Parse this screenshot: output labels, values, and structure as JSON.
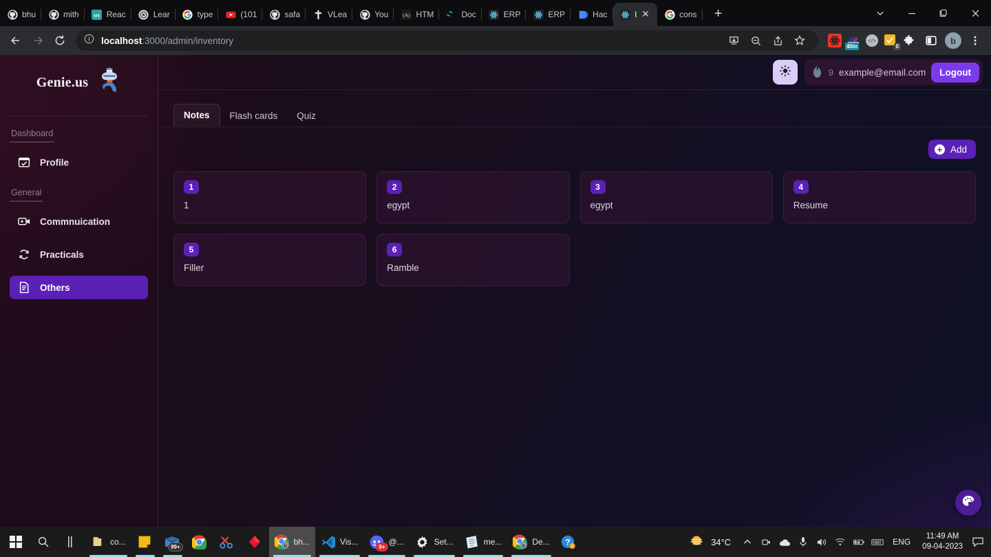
{
  "browser": {
    "tabs": [
      {
        "title": "bhu",
        "icon": "github-icon",
        "active": false
      },
      {
        "title": "mith",
        "icon": "github-icon",
        "active": false
      },
      {
        "title": "Reac",
        "icon": "sjs-icon",
        "active": false
      },
      {
        "title": "Lear",
        "icon": "openai-icon",
        "active": false
      },
      {
        "title": "type",
        "icon": "google-icon",
        "active": false
      },
      {
        "title": "(101",
        "icon": "youtube-icon",
        "active": false
      },
      {
        "title": "safa",
        "icon": "github-icon",
        "active": false
      },
      {
        "title": "VLea",
        "icon": "cross-icon",
        "active": false
      },
      {
        "title": "You",
        "icon": "github-icon",
        "active": false
      },
      {
        "title": "HTM",
        "icon": "a11y-icon",
        "active": false
      },
      {
        "title": "Doc",
        "icon": "tailwind-icon",
        "active": false
      },
      {
        "title": "ERP",
        "icon": "react-icon",
        "active": false
      },
      {
        "title": "ERP",
        "icon": "react-icon",
        "active": false
      },
      {
        "title": "Hac",
        "icon": "hackerrank-icon",
        "active": false
      },
      {
        "title": "l",
        "icon": "react-icon",
        "active": true
      },
      {
        "title": "cons",
        "icon": "google-icon",
        "active": false
      }
    ],
    "new_tab_label": "+",
    "window_controls": [
      "tab-search-chevron",
      "minimize",
      "restore",
      "close"
    ],
    "toolbar": {
      "back_icon": "back-arrow-icon",
      "forward_icon": "forward-arrow-icon",
      "reload_icon": "reload-icon",
      "url_prefix": "localhost",
      "url_suffix": ":3000/admin/inventory",
      "info_icon": "info-circle-icon",
      "actions": [
        "install-icon",
        "zoom-out-icon",
        "share-icon",
        "bookmark-star-icon"
      ],
      "extensions": [
        {
          "name": "react-devtools-extension",
          "badge": ""
        },
        {
          "name": "timer-extension",
          "badge": "40m"
        },
        {
          "name": "code-extension",
          "badge": ""
        },
        {
          "name": "tasks-extension",
          "badge": "0"
        },
        {
          "name": "puzzle-extensions-icon",
          "badge": ""
        },
        {
          "name": "side-panel-icon",
          "badge": ""
        }
      ],
      "profile_initial": "b",
      "menu_icon": "three-dot-menu-icon"
    }
  },
  "app": {
    "brand": {
      "name": "Genie.us",
      "logo": "genie-logo"
    },
    "sidebar": {
      "sections": [
        {
          "label": "Dashboard",
          "items": [
            {
              "label": "Profile",
              "icon": "calendar-check-icon",
              "active": false
            }
          ]
        },
        {
          "label": "General",
          "items": [
            {
              "label": "Commnuication",
              "icon": "video-add-icon",
              "active": false
            },
            {
              "label": "Practicals",
              "icon": "refresh-icon",
              "active": false
            },
            {
              "label": "Others",
              "icon": "document-icon",
              "active": true
            }
          ]
        }
      ]
    },
    "header": {
      "theme_toggle_icon": "sun-icon",
      "streak_icon": "flame-icon",
      "streak_count": "9",
      "email": "example@email.com",
      "logout_label": "Logout"
    },
    "tabs": [
      {
        "label": "Notes",
        "active": true
      },
      {
        "label": "Flash cards",
        "active": false
      },
      {
        "label": "Quiz",
        "active": false
      }
    ],
    "add_button": {
      "label": "Add",
      "icon": "plus-circle-icon"
    },
    "notes": [
      {
        "number": "1",
        "title": "1"
      },
      {
        "number": "2",
        "title": "egypt"
      },
      {
        "number": "3",
        "title": "egypt"
      },
      {
        "number": "4",
        "title": "Resume"
      },
      {
        "number": "5",
        "title": "Filler"
      },
      {
        "number": "6",
        "title": "Ramble"
      }
    ],
    "fab": {
      "icon": "palette-icon"
    },
    "colors": {
      "accent": "#5b21b6",
      "accent_bright": "#7c3aed",
      "theme_toggle_bg": "#d8cdf6",
      "card_bg": "#301430",
      "sidebar_border": "#35203a"
    }
  },
  "taskbar": {
    "start_icon": "windows-start-icon",
    "search_icon": "search-icon",
    "taskview_icon": "task-view-icon",
    "items": [
      {
        "label": "co...",
        "icon": "folder-icon",
        "running": true,
        "focused": false,
        "badge": ""
      },
      {
        "label": "",
        "icon": "sticky-notes-icon",
        "running": true,
        "focused": false,
        "badge": ""
      },
      {
        "label": "",
        "icon": "mail-icon",
        "running": true,
        "focused": false,
        "badge": "99+"
      },
      {
        "label": "",
        "icon": "chrome-icon",
        "running": false,
        "focused": false,
        "badge": ""
      },
      {
        "label": "",
        "icon": "snipping-tool-icon",
        "running": false,
        "focused": false,
        "badge": ""
      },
      {
        "label": "",
        "icon": "framer-icon",
        "running": false,
        "focused": false,
        "badge": ""
      },
      {
        "label": "bh...",
        "icon": "chrome-profile-icon",
        "running": true,
        "focused": true,
        "badge": ""
      },
      {
        "label": "Vis...",
        "icon": "vscode-icon",
        "running": true,
        "focused": false,
        "badge": ""
      },
      {
        "label": "@...",
        "icon": "discord-icon",
        "running": true,
        "focused": false,
        "badge": "9+"
      },
      {
        "label": "Set...",
        "icon": "settings-gear-icon",
        "running": true,
        "focused": false,
        "badge": ""
      },
      {
        "label": "me...",
        "icon": "notepad-icon",
        "running": true,
        "focused": false,
        "badge": ""
      },
      {
        "label": "De...",
        "icon": "chrome-profile-icon",
        "running": true,
        "focused": false,
        "badge": ""
      },
      {
        "label": "",
        "icon": "help-icon",
        "running": false,
        "focused": false,
        "badge": ""
      }
    ],
    "weather": {
      "icon": "sun-cloud-icon",
      "temperature": "34°C"
    },
    "tray_icons": [
      "chevron-up-icon",
      "camera-icon",
      "onedrive-cloud-icon",
      "microphone-icon",
      "speaker-icon",
      "wifi-icon",
      "battery-charging-icon",
      "keyboard-icon"
    ],
    "language": "ENG",
    "time": "11:49 AM",
    "date": "09-04-2023",
    "notification_icon": "notification-chat-icon"
  }
}
